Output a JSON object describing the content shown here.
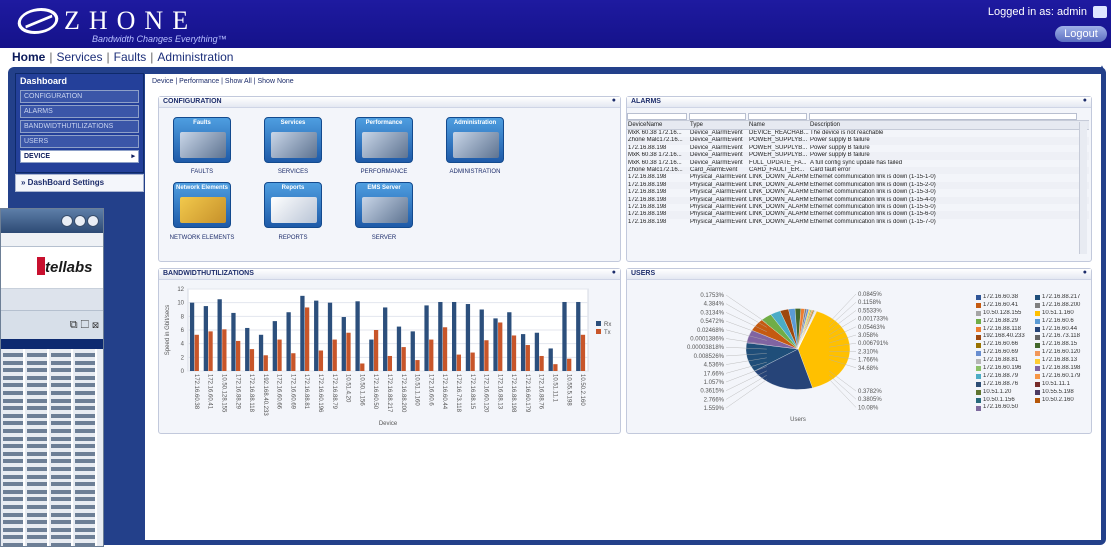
{
  "header": {
    "logo_text": "ZHONE",
    "tagline": "Bandwidth Changes Everything™",
    "logged_in": "Logged in as: admin",
    "logout": "Logout"
  },
  "nav": {
    "home": "Home",
    "services": "Services",
    "faults": "Faults",
    "administration": "Administration"
  },
  "sidebar": {
    "title": "Dashboard",
    "items": [
      {
        "label": "CONFIGURATION"
      },
      {
        "label": "ALARMS"
      },
      {
        "label": "BANDWIDTHUTILIZATIONS"
      },
      {
        "label": "USERS"
      },
      {
        "label": "DEVICE"
      }
    ],
    "settings": "DashBoard Settings"
  },
  "tabs": {
    "device": "Device",
    "performance": "Performance",
    "show_all": "Show All",
    "show_none": "Show None"
  },
  "overlay": {
    "brand": "tellabs"
  },
  "configuration": {
    "title": "CONFIGURATION",
    "tiles": [
      {
        "tile": "Faults",
        "label": "FAULTS"
      },
      {
        "tile": "Services",
        "label": "SERVICES"
      },
      {
        "tile": "Performance",
        "label": "PERFORMANCE"
      },
      {
        "tile": "Administration",
        "label": "ADMINISTRATION"
      },
      {
        "tile": "Network Elements",
        "label": "NETWORK ELEMENTS"
      },
      {
        "tile": "Reports",
        "label": "REPORTS"
      },
      {
        "tile": "EMS Server",
        "label": "SERVER"
      }
    ]
  },
  "alarms": {
    "title": "ALARMS",
    "columns": [
      "DeviceName",
      "Type",
      "Name",
      "Description"
    ],
    "rows": [
      [
        "MxK 60.38 172.16...",
        "Device_AlarmEvent",
        "DEVICE_REACHAB...",
        "The device is not reachable"
      ],
      [
        "Zhone Malc172.16...",
        "Device_AlarmEvent",
        "POWER_SUPPLYB...",
        "Power supply B failure"
      ],
      [
        "172.16.88.198",
        "Device_AlarmEvent",
        "POWER_SUPPLYB...",
        "Power supply B failure"
      ],
      [
        "MxK 60.38 172.16...",
        "Device_AlarmEvent",
        "POWER_SUPPLYB...",
        "Power supply B failure"
      ],
      [
        "MxK 60.38 172.16...",
        "Device_AlarmEvent",
        "FULL_UPDATE_FA...",
        "A full config sync update has failed"
      ],
      [
        "Zhone Malc172.16...",
        "Card_AlarmEvent",
        "CARD_FAULT_ER...",
        "Card fault error"
      ],
      [
        "172.16.88.198",
        "Physical_AlarmEvent",
        "LINK_DOWN_ALARM",
        "Ethernet communication link is down (1-15-1-0)"
      ],
      [
        "172.16.88.198",
        "Physical_AlarmEvent",
        "LINK_DOWN_ALARM",
        "Ethernet communication link is down (1-15-2-0)"
      ],
      [
        "172.16.88.198",
        "Physical_AlarmEvent",
        "LINK_DOWN_ALARM",
        "Ethernet communication link is down (1-15-3-0)"
      ],
      [
        "172.16.88.198",
        "Physical_AlarmEvent",
        "LINK_DOWN_ALARM",
        "Ethernet communication link is down (1-15-4-0)"
      ],
      [
        "172.16.88.198",
        "Physical_AlarmEvent",
        "LINK_DOWN_ALARM",
        "Ethernet communication link is down (1-15-5-0)"
      ],
      [
        "172.16.88.198",
        "Physical_AlarmEvent",
        "LINK_DOWN_ALARM",
        "Ethernet communication link is down (1-15-6-0)"
      ],
      [
        "172.16.88.198",
        "Physical_AlarmEvent",
        "LINK_DOWN_ALARM",
        "Ethernet communication link is down (1-15-7-0)"
      ]
    ]
  },
  "bandwidth": {
    "title": "BANDWIDTHUTILIZATIONS"
  },
  "users": {
    "title": "USERS",
    "xlabel": "Users",
    "legend": [
      [
        "172.16.60.38",
        "#2f5597"
      ],
      [
        "172.16.88.217",
        "#1f4e79"
      ],
      [
        "172.16.60.41",
        "#c55a11"
      ],
      [
        "172.16.88.200",
        "#7f7f7f"
      ],
      [
        "10.50.128.155",
        "#a5a5a5"
      ],
      [
        "10.51.1.160",
        "#ffc000"
      ],
      [
        "172.16.88.29",
        "#70ad47"
      ],
      [
        "172.16.60.6",
        "#5b9bd5"
      ],
      [
        "172.16.88.118",
        "#ed7d31"
      ],
      [
        "172.16.60.44",
        "#264478"
      ],
      [
        "192.168.40.233",
        "#9e480e"
      ],
      [
        "172.16.73.118",
        "#636363"
      ],
      [
        "172.16.60.66",
        "#997300"
      ],
      [
        "172.16.88.15",
        "#43682b"
      ],
      [
        "172.16.60.69",
        "#698ed0"
      ],
      [
        "172.16.60.120",
        "#f1975a"
      ],
      [
        "172.16.88.81",
        "#b7b7b7"
      ],
      [
        "172.16.88.13",
        "#ffcd33"
      ],
      [
        "172.16.60.196",
        "#8cc168"
      ],
      [
        "172.16.88.198",
        "#8064a2"
      ],
      [
        "172.16.88.79",
        "#4bacc6"
      ],
      [
        "172.16.60.179",
        "#f79646"
      ],
      [
        "172.16.88.76",
        "#2c4d75"
      ],
      [
        "10.51.11.1",
        "#772c2a"
      ],
      [
        "10.51.1.20",
        "#5f7530"
      ],
      [
        "10.55.5.198",
        "#4d3b62"
      ],
      [
        "10.50.1.156",
        "#276a7c"
      ],
      [
        "10.50.2.160",
        "#b65708"
      ],
      [
        "172.16.60.50",
        "#7e6a9e"
      ],
      [
        "",
        "#ffffff"
      ]
    ],
    "labels_left": [
      "0.1753%",
      "4.384%",
      "0.3134%",
      "0.5472%",
      "0.02468%",
      "0.0001386%",
      "0.00003818%",
      "0.008526%",
      "4.536%",
      "17.66%",
      "1.057%",
      "0.3615%",
      "2.766%",
      "1.559%"
    ],
    "labels_right": [
      "0.0845%",
      "0.1158%",
      "0.5533%",
      "0.001733%",
      "0.05463%",
      "3.058%",
      "0.006791%",
      "2.310%",
      "1.766%",
      "34.68%",
      "0.3782%",
      "0.3805%",
      "10.08%"
    ]
  },
  "chart_data": [
    {
      "type": "bar",
      "title": "BANDWIDTHUTILIZATIONS",
      "xlabel": "Device",
      "ylabel": "Speed in Gbit/secs",
      "ylim": [
        0,
        12
      ],
      "yticks": [
        0,
        2,
        4,
        6,
        8,
        10,
        12
      ],
      "legend": "right",
      "categories": [
        "172.16.60.38",
        "172.16.60.41",
        "10.50.128.155",
        "172.16.88.29",
        "172.16.88.118",
        "192.168.40.233",
        "172.16.60.66",
        "172.16.60.69",
        "172.16.88.81",
        "172.16.60.196",
        "172.16.88.79",
        "10.51.4.20",
        "10.50.1.156",
        "172.16.60.50",
        "172.16.88.217",
        "172.16.88.200",
        "10.51.1.160",
        "172.16.60.6",
        "172.16.60.44",
        "172.16.73.118",
        "172.16.88.15",
        "172.16.60.120",
        "172.16.88.13",
        "172.16.88.198",
        "172.16.60.179",
        "172.16.88.76",
        "10.51.11.1",
        "10.55.5.198",
        "10.50.2.160"
      ],
      "series": [
        {
          "name": "Rx",
          "color": "#2c4f7c",
          "values": [
            10,
            9.5,
            10.5,
            8.5,
            6.3,
            5.3,
            7.3,
            8.6,
            11,
            10.3,
            10,
            7.9,
            10.2,
            4.6,
            9.3,
            6.5,
            5.8,
            9.6,
            10.1,
            10.1,
            9.8,
            9,
            7.7,
            8.6,
            5.4,
            5.6,
            3.3,
            10.1,
            10.1
          ]
        },
        {
          "name": "Tx",
          "color": "#c8562a",
          "values": [
            5.3,
            5.8,
            6.1,
            4.4,
            3.2,
            2.3,
            4.6,
            2.6,
            9.3,
            3,
            4.6,
            5.6,
            1.1,
            6,
            2.2,
            3.5,
            1.6,
            4.6,
            6.4,
            2.4,
            2.7,
            4.5,
            7.1,
            5.2,
            3.8,
            2.2,
            1,
            1.8,
            5.3
          ]
        }
      ]
    },
    {
      "type": "pie",
      "title": "USERS",
      "xlabel": "Users",
      "slices": [
        {
          "label": "172.16.88.198",
          "value": 34.68,
          "color": "#ffc000"
        },
        {
          "label": "172.16.60.69",
          "value": 17.66,
          "color": "#264478"
        },
        {
          "label": "172.16.60.196",
          "value": 10.08,
          "color": "#1f4e79"
        },
        {
          "label": "172.16.88.79",
          "value": 4.536,
          "color": "#8064a2"
        },
        {
          "label": "172.16.60.41",
          "value": 4.384,
          "color": "#c55a11"
        },
        {
          "label": "172.16.60.179",
          "value": 3.058,
          "color": "#70ad47"
        },
        {
          "label": "172.16.88.76",
          "value": 2.766,
          "color": "#4bacc6"
        },
        {
          "label": "10.51.11.1",
          "value": 2.31,
          "color": "#9e480e"
        },
        {
          "label": "10.51.1.20",
          "value": 1.766,
          "color": "#5b9bd5"
        },
        {
          "label": "10.55.5.198",
          "value": 1.559,
          "color": "#43682b"
        },
        {
          "label": "10.50.1.156",
          "value": 1.057,
          "color": "#ed7d31"
        },
        {
          "label": "10.50.2.160",
          "value": 0.5533,
          "color": "#7f7f7f"
        },
        {
          "label": "172.16.60.50",
          "value": 0.5472,
          "color": "#698ed0"
        },
        {
          "label": "10.50.128.155",
          "value": 0.3805,
          "color": "#ffcd33"
        },
        {
          "label": "172.16.88.29",
          "value": 0.3782,
          "color": "#8cc168"
        },
        {
          "label": "172.16.88.118",
          "value": 0.3615,
          "color": "#f79646"
        },
        {
          "label": "192.168.40.233",
          "value": 0.3134,
          "color": "#997300"
        },
        {
          "label": "172.16.60.66",
          "value": 0.1753,
          "color": "#636363"
        },
        {
          "label": "172.16.88.81",
          "value": 0.1158,
          "color": "#a5a5a5"
        },
        {
          "label": "172.16.88.217",
          "value": 0.0845,
          "color": "#2f5597"
        },
        {
          "label": "172.16.88.200",
          "value": 0.05463,
          "color": "#f1975a"
        },
        {
          "label": "10.51.1.160",
          "value": 0.02468,
          "color": "#b7b7b7"
        },
        {
          "label": "172.16.60.6",
          "value": 0.008526,
          "color": "#772c2a"
        },
        {
          "label": "172.16.60.44",
          "value": 0.006791,
          "color": "#5f7530"
        },
        {
          "label": "172.16.73.118",
          "value": 0.001733,
          "color": "#4d3b62"
        },
        {
          "label": "172.16.88.15",
          "value": 0.0001386,
          "color": "#276a7c"
        },
        {
          "label": "172.16.60.120",
          "value": 3.818e-05,
          "color": "#b65708"
        }
      ]
    }
  ]
}
